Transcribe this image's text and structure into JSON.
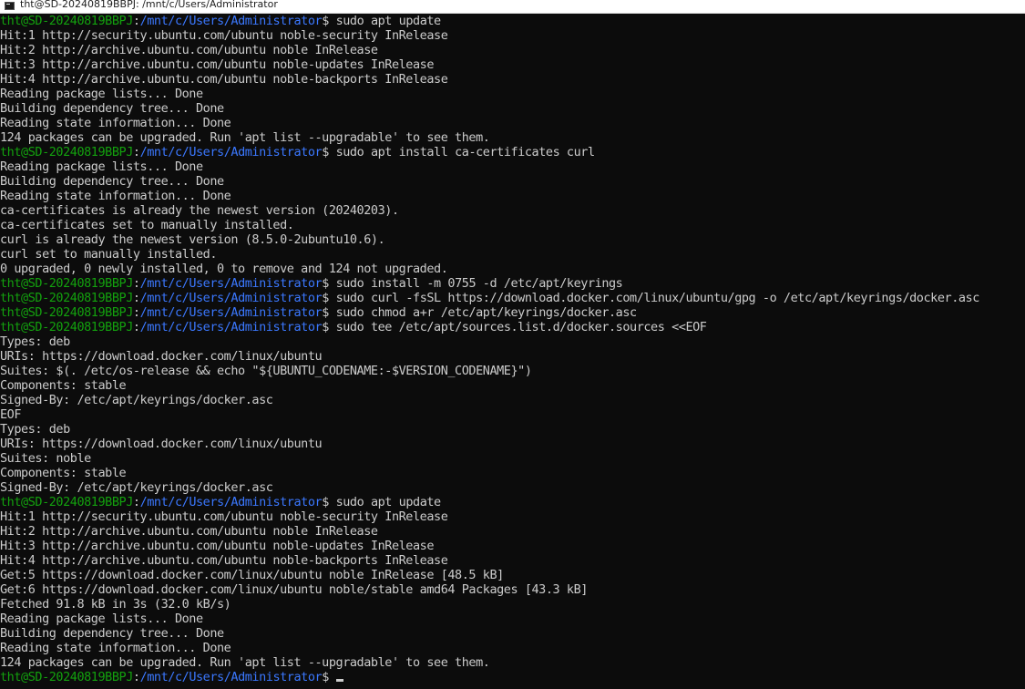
{
  "window": {
    "title": "tht@SD-20240819BBPJ: /mnt/c/Users/Administrator",
    "icon": "terminal-icon"
  },
  "colors": {
    "background": "#0c0c0c",
    "text": "#cccccc",
    "prompt_user": "#13a10e",
    "prompt_path": "#3b78ff"
  },
  "prompt": {
    "user_host": "tht@SD-20240819BBPJ",
    "path": "/mnt/c/Users/Administrator"
  },
  "lines": [
    {
      "type": "prompt",
      "command": "sudo apt update"
    },
    {
      "type": "output",
      "text": "Hit:1 http://security.ubuntu.com/ubuntu noble-security InRelease"
    },
    {
      "type": "output",
      "text": "Hit:2 http://archive.ubuntu.com/ubuntu noble InRelease"
    },
    {
      "type": "output",
      "text": "Hit:3 http://archive.ubuntu.com/ubuntu noble-updates InRelease"
    },
    {
      "type": "output",
      "text": "Hit:4 http://archive.ubuntu.com/ubuntu noble-backports InRelease"
    },
    {
      "type": "output",
      "text": "Reading package lists... Done"
    },
    {
      "type": "output",
      "text": "Building dependency tree... Done"
    },
    {
      "type": "output",
      "text": "Reading state information... Done"
    },
    {
      "type": "output",
      "text": "124 packages can be upgraded. Run 'apt list --upgradable' to see them."
    },
    {
      "type": "prompt",
      "command": "sudo apt install ca-certificates curl"
    },
    {
      "type": "output",
      "text": "Reading package lists... Done"
    },
    {
      "type": "output",
      "text": "Building dependency tree... Done"
    },
    {
      "type": "output",
      "text": "Reading state information... Done"
    },
    {
      "type": "output",
      "text": "ca-certificates is already the newest version (20240203)."
    },
    {
      "type": "output",
      "text": "ca-certificates set to manually installed."
    },
    {
      "type": "output",
      "text": "curl is already the newest version (8.5.0-2ubuntu10.6)."
    },
    {
      "type": "output",
      "text": "curl set to manually installed."
    },
    {
      "type": "output",
      "text": "0 upgraded, 0 newly installed, 0 to remove and 124 not upgraded."
    },
    {
      "type": "prompt",
      "command": "sudo install -m 0755 -d /etc/apt/keyrings"
    },
    {
      "type": "prompt",
      "command": "sudo curl -fsSL https://download.docker.com/linux/ubuntu/gpg -o /etc/apt/keyrings/docker.asc"
    },
    {
      "type": "prompt",
      "command": "sudo chmod a+r /etc/apt/keyrings/docker.asc"
    },
    {
      "type": "prompt",
      "command": "sudo tee /etc/apt/sources.list.d/docker.sources <<EOF"
    },
    {
      "type": "output",
      "text": "Types: deb"
    },
    {
      "type": "output",
      "text": "URIs: https://download.docker.com/linux/ubuntu"
    },
    {
      "type": "output",
      "text": "Suites: $(. /etc/os-release && echo \"${UBUNTU_CODENAME:-$VERSION_CODENAME}\")"
    },
    {
      "type": "output",
      "text": "Components: stable"
    },
    {
      "type": "output",
      "text": "Signed-By: /etc/apt/keyrings/docker.asc"
    },
    {
      "type": "output",
      "text": "EOF"
    },
    {
      "type": "output",
      "text": "Types: deb"
    },
    {
      "type": "output",
      "text": "URIs: https://download.docker.com/linux/ubuntu"
    },
    {
      "type": "output",
      "text": "Suites: noble"
    },
    {
      "type": "output",
      "text": "Components: stable"
    },
    {
      "type": "output",
      "text": "Signed-By: /etc/apt/keyrings/docker.asc"
    },
    {
      "type": "prompt",
      "command": "sudo apt update"
    },
    {
      "type": "output",
      "text": "Hit:1 http://security.ubuntu.com/ubuntu noble-security InRelease"
    },
    {
      "type": "output",
      "text": "Hit:2 http://archive.ubuntu.com/ubuntu noble InRelease"
    },
    {
      "type": "output",
      "text": "Hit:3 http://archive.ubuntu.com/ubuntu noble-updates InRelease"
    },
    {
      "type": "output",
      "text": "Hit:4 http://archive.ubuntu.com/ubuntu noble-backports InRelease"
    },
    {
      "type": "output",
      "text": "Get:5 https://download.docker.com/linux/ubuntu noble InRelease [48.5 kB]"
    },
    {
      "type": "output",
      "text": "Get:6 https://download.docker.com/linux/ubuntu noble/stable amd64 Packages [43.3 kB]"
    },
    {
      "type": "output",
      "text": "Fetched 91.8 kB in 3s (32.0 kB/s)"
    },
    {
      "type": "output",
      "text": "Reading package lists... Done"
    },
    {
      "type": "output",
      "text": "Building dependency tree... Done"
    },
    {
      "type": "output",
      "text": "Reading state information... Done"
    },
    {
      "type": "output",
      "text": "124 packages can be upgraded. Run 'apt list --upgradable' to see them."
    },
    {
      "type": "prompt",
      "command": "",
      "cursor": true
    }
  ]
}
